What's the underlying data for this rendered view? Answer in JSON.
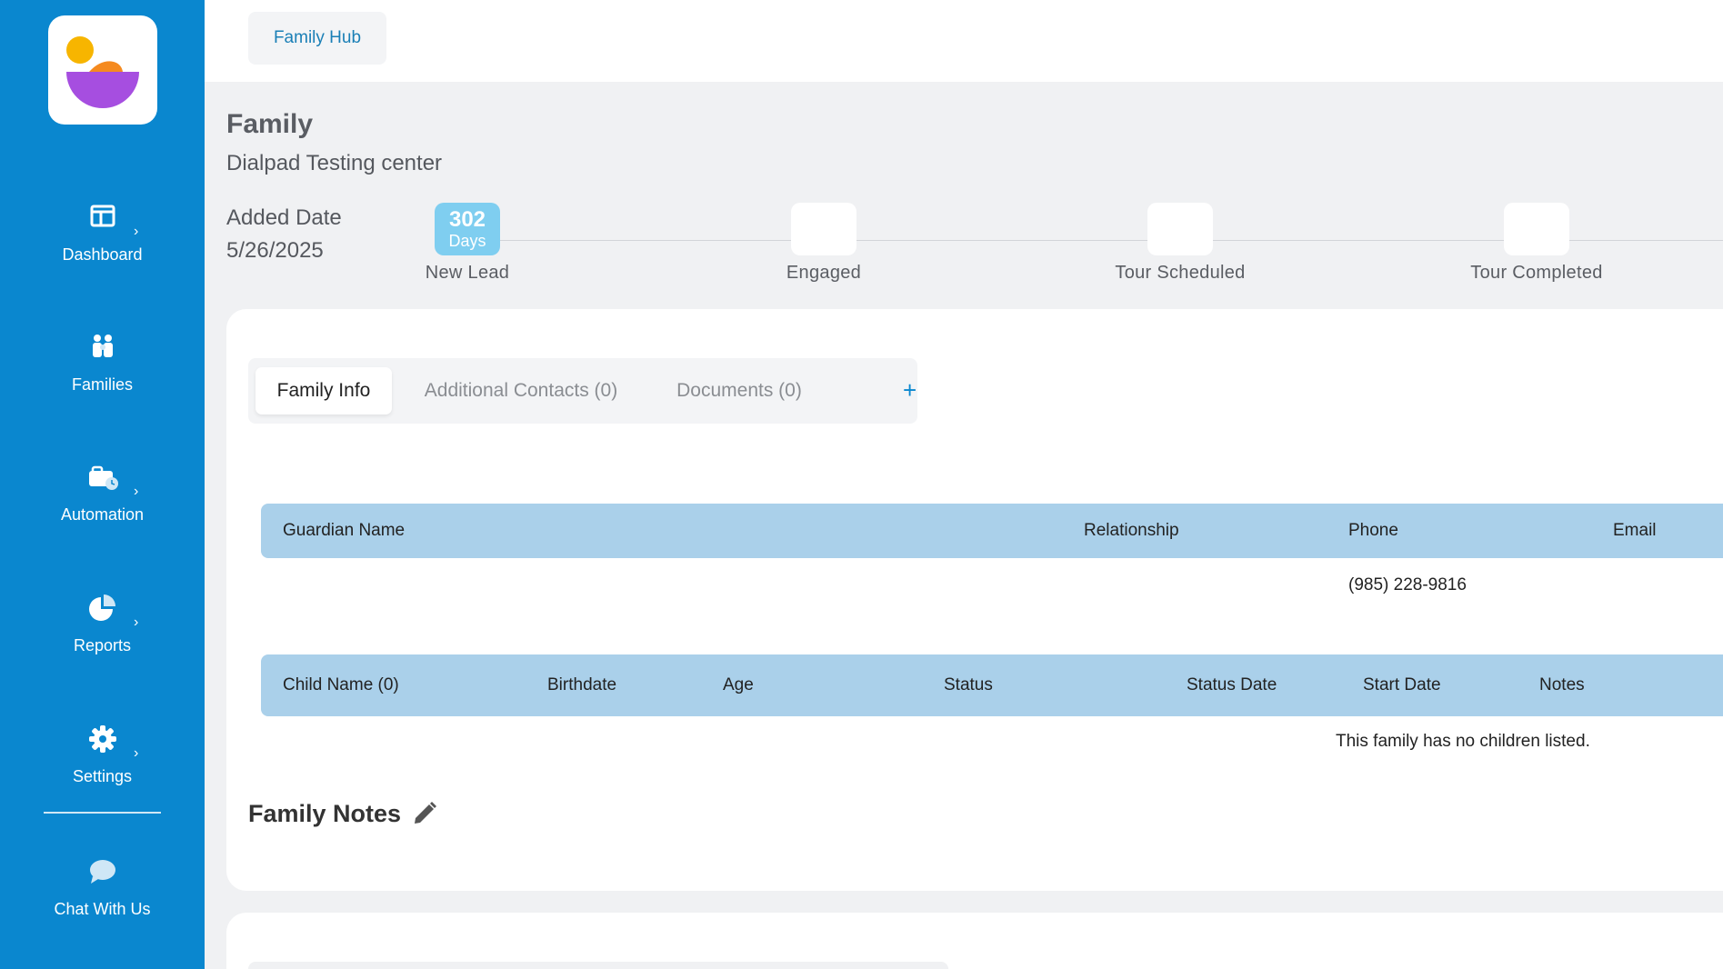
{
  "sidebar": {
    "items": [
      {
        "label": "Dashboard",
        "icon": "dashboard-icon",
        "has_chevron": true
      },
      {
        "label": "Families",
        "icon": "families-icon",
        "has_chevron": false
      },
      {
        "label": "Automation",
        "icon": "automation-icon",
        "has_chevron": true
      },
      {
        "label": "Reports",
        "icon": "reports-icon",
        "has_chevron": true
      },
      {
        "label": "Settings",
        "icon": "gear-icon",
        "has_chevron": true
      },
      {
        "label": "Chat With Us",
        "icon": "chat-icon",
        "has_chevron": false
      }
    ],
    "chevron": "›"
  },
  "topbar": {
    "tab_label": "Family Hub"
  },
  "header": {
    "title": "Family",
    "subtitle": "Dialpad Testing center",
    "added_label": "Added Date",
    "added_date": "5/26/2025"
  },
  "pipeline": {
    "stages": [
      {
        "label": "New Lead",
        "count": "302",
        "unit": "Days"
      },
      {
        "label": "Engaged"
      },
      {
        "label": "Tour Scheduled"
      },
      {
        "label": "Tour Completed"
      }
    ]
  },
  "tabs": {
    "items": [
      "Family Info",
      "Additional Contacts (0)",
      "Documents (0)"
    ],
    "add_label": "+"
  },
  "guardians": {
    "columns": [
      "Guardian Name",
      "Relationship",
      "Phone",
      "Email"
    ],
    "rows": [
      {
        "name": "",
        "relationship": "",
        "phone": "(985) 228-9816",
        "email": ""
      }
    ]
  },
  "children": {
    "columns": [
      "Child Name (0)",
      "Birthdate",
      "Age",
      "Status",
      "Status Date",
      "Start Date",
      "Notes"
    ],
    "empty_message": "This family has no children listed."
  },
  "notes": {
    "title": "Family Notes"
  },
  "colors": {
    "sidebar": "#0a87cf",
    "table_header": "#aad0ea",
    "active_stage": "#7fcef0",
    "accent": "#1a7fb6"
  }
}
